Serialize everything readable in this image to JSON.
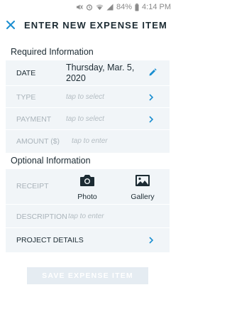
{
  "status_bar": {
    "battery": "84%",
    "time": "4:14 PM"
  },
  "header": {
    "title": "ENTER NEW EXPENSE ITEM"
  },
  "required": {
    "heading": "Required Information",
    "date": {
      "label": "DATE",
      "value": "Thursday, Mar. 5, 2020"
    },
    "type": {
      "label": "TYPE",
      "placeholder": "tap to select"
    },
    "payment": {
      "label": "PAYMENT",
      "placeholder": "tap to select"
    },
    "amount": {
      "label": "AMOUNT ($)",
      "placeholder": "tap to enter"
    }
  },
  "optional": {
    "heading": "Optional Information",
    "receipt": {
      "label": "RECEIPT",
      "photo_label": "Photo",
      "gallery_label": "Gallery"
    },
    "description": {
      "label": "DESCRIPTION",
      "placeholder": "tap to enter"
    },
    "project": {
      "label": "PROJECT DETAILS"
    }
  },
  "footer": {
    "save_label": "SAVE EXPENSE ITEM"
  },
  "colors": {
    "accent": "#1a8ed0",
    "row_background": "#f1f5f8",
    "muted_text": "#a9b3ba",
    "disabled_button": "#e5ecf2"
  }
}
